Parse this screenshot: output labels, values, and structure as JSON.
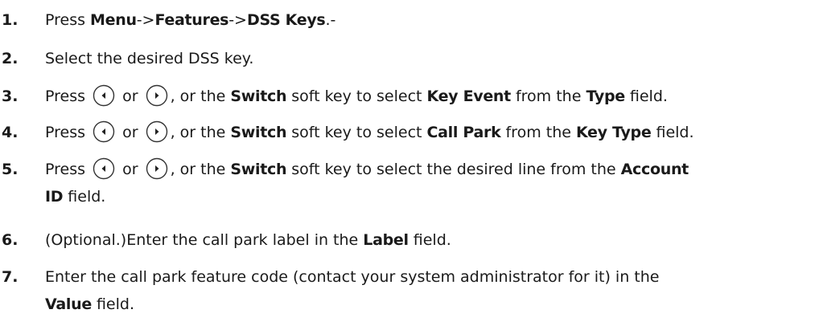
{
  "steps": [
    {
      "num": "1.",
      "parts": [
        "Press ",
        "Menu",
        "->",
        "Features",
        "->",
        "DSS Keys",
        ".-"
      ]
    },
    {
      "num": "2.",
      "parts": [
        "Select the desired DSS key."
      ]
    },
    {
      "num": "3.",
      "parts": [
        "Press ",
        "or",
        ", or the ",
        "Switch",
        " soft key to select ",
        "Key Event",
        " from the ",
        "Type",
        " field."
      ]
    },
    {
      "num": "4.",
      "parts": [
        "Press ",
        "or",
        ", or the ",
        "Switch",
        " soft key to select ",
        "Call Park",
        " from the ",
        "Key Type",
        " field."
      ]
    },
    {
      "num": "5.",
      "parts": [
        "Press ",
        "or",
        ", or the ",
        "Switch",
        " soft key to select the desired line from the ",
        "Account",
        "ID",
        " field."
      ]
    },
    {
      "num": "6.",
      "parts": [
        "(Optional.)Enter the call park label in the ",
        "Label",
        " field."
      ]
    },
    {
      "num": "7.",
      "parts": [
        "Enter the call park feature code (contact your system administrator for it) in the",
        "Value",
        " field."
      ]
    }
  ],
  "icons": {
    "left": "left-arrow-key-icon",
    "right": "right-arrow-key-icon"
  }
}
